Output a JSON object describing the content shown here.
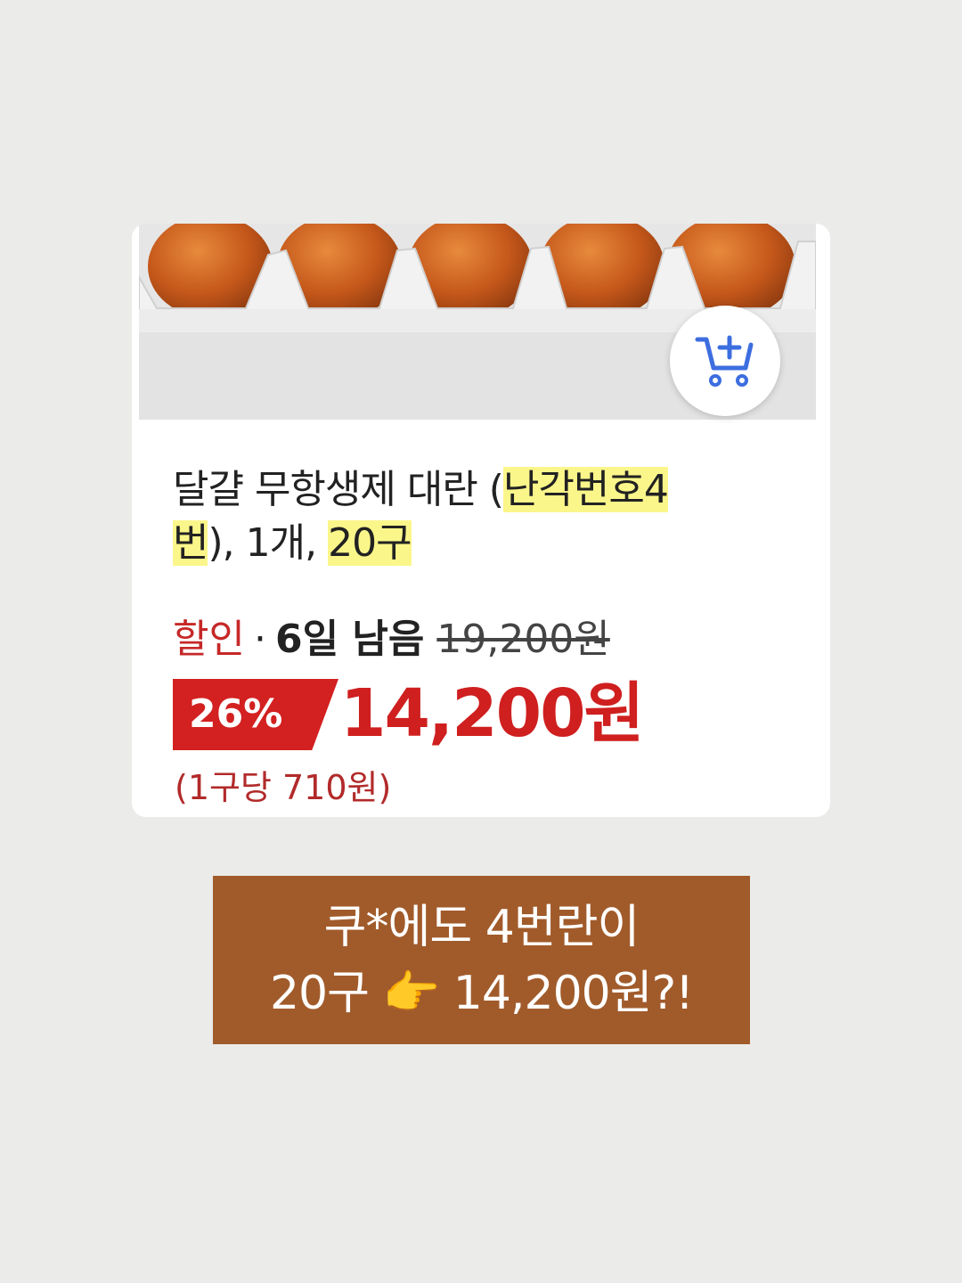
{
  "product": {
    "title_plain_1": "달걀 무항생제 대란 (",
    "title_hl_1": "난각번호4",
    "title_hl_2": "번",
    "title_plain_2": "), 1개, ",
    "title_hl_3": "20구"
  },
  "sale": {
    "label": "할인",
    "separator": "·",
    "days_left": "6일 남음",
    "original_price": "19,200원"
  },
  "discount_badge": "26%",
  "price": "14,200원",
  "unit_price": "(1구당 710원)",
  "cart_icon": "cart-plus-icon",
  "caption": {
    "line1": "쿠*에도 4번란이",
    "line2_a": "20구 ",
    "line2_emoji": "👉",
    "line2_b": " 14,200원?!"
  },
  "colors": {
    "background": "#ebebe9",
    "discount_red": "#d32020",
    "highlight": "#fbf68a",
    "caption_bg": "#a15b2b",
    "cart_blue": "#3d6ee0"
  }
}
